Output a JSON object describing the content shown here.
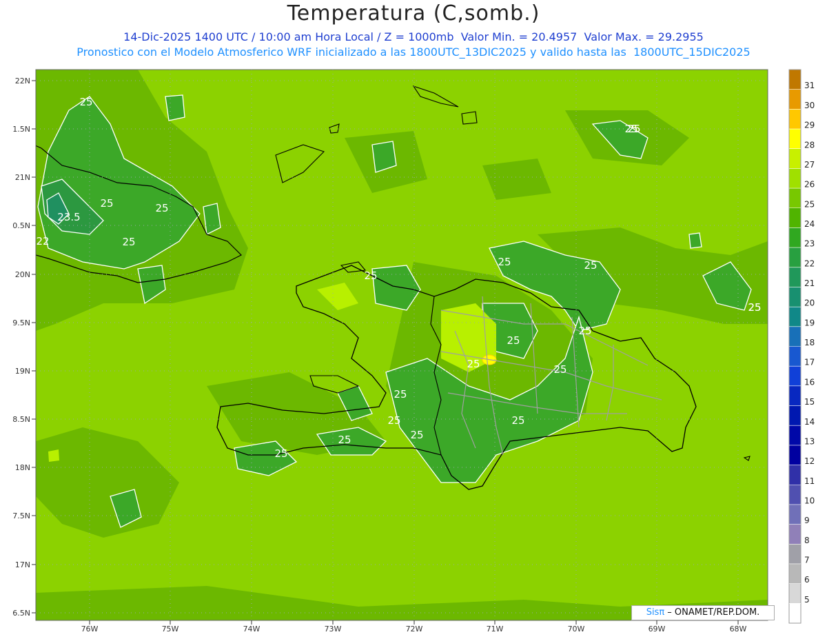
{
  "header": {
    "title": "Temperatura (C,somb.)",
    "line1": "14-Dic-2025 1400 UTC / 10:00 am Hora Local / Z = 1000mb  Valor Min. = 20.4957  Valor Max. = 29.2955",
    "line2": "Pronostico con el Modelo Atmosferico WRF inicializado a las 1800UTC_13DIC2025 y valido hasta las  1800UTC_15DIC2025"
  },
  "lat_labels": [
    "22N",
    "1.5N",
    "21N",
    "0.5N",
    "20N",
    "9.5N",
    "19N",
    "8.5N",
    "18N",
    "7.5N",
    "17N",
    "6.5N"
  ],
  "lon_labels": [
    "76W",
    "75W",
    "74W",
    "73W",
    "72W",
    "71W",
    "70W",
    "69W",
    "68W"
  ],
  "colorbar": {
    "labels": [
      "31",
      "30",
      "29",
      "28",
      "27",
      "26",
      "25",
      "24",
      "23",
      "22",
      "21",
      "20",
      "19",
      "18",
      "17",
      "16",
      "15",
      "14",
      "13",
      "12",
      "11",
      "10",
      "9",
      "8",
      "7",
      "6",
      "5"
    ],
    "colors": [
      "#c07800",
      "#e89a00",
      "#ffc800",
      "#ffff00",
      "#c8f000",
      "#a0e000",
      "#78c800",
      "#50b400",
      "#30a820",
      "#28a040",
      "#20985a",
      "#189070",
      "#108888",
      "#1870b8",
      "#1858d0",
      "#1040d8",
      "#0828c0",
      "#0018b0",
      "#0008a8",
      "#0000a0",
      "#3030a8",
      "#5050b0",
      "#7070b8",
      "#9080b8",
      "#a0a0a8",
      "#b8b8b8",
      "#d8d8d8",
      "#ffffff"
    ]
  },
  "map_colors": {
    "ocean": "#8cd200",
    "band_25": "#6cb800",
    "band_24": "#3ca828",
    "band_23": "#2c9840",
    "band_27": "#b8f000",
    "band_28": "#ffff00",
    "coast": "#000000",
    "province": "#a0a0a0"
  },
  "contour_labels": [
    "25",
    "25",
    "23.5",
    "25",
    "22",
    "25",
    "25",
    "25",
    "25",
    "25",
    "25",
    "25",
    "25",
    "25",
    "25",
    "25",
    "25",
    "25",
    "25",
    "25",
    "25",
    "25",
    "25"
  ],
  "credit": {
    "brand": "Sisπ",
    "text": " – ONAMET/REP.DOM."
  }
}
